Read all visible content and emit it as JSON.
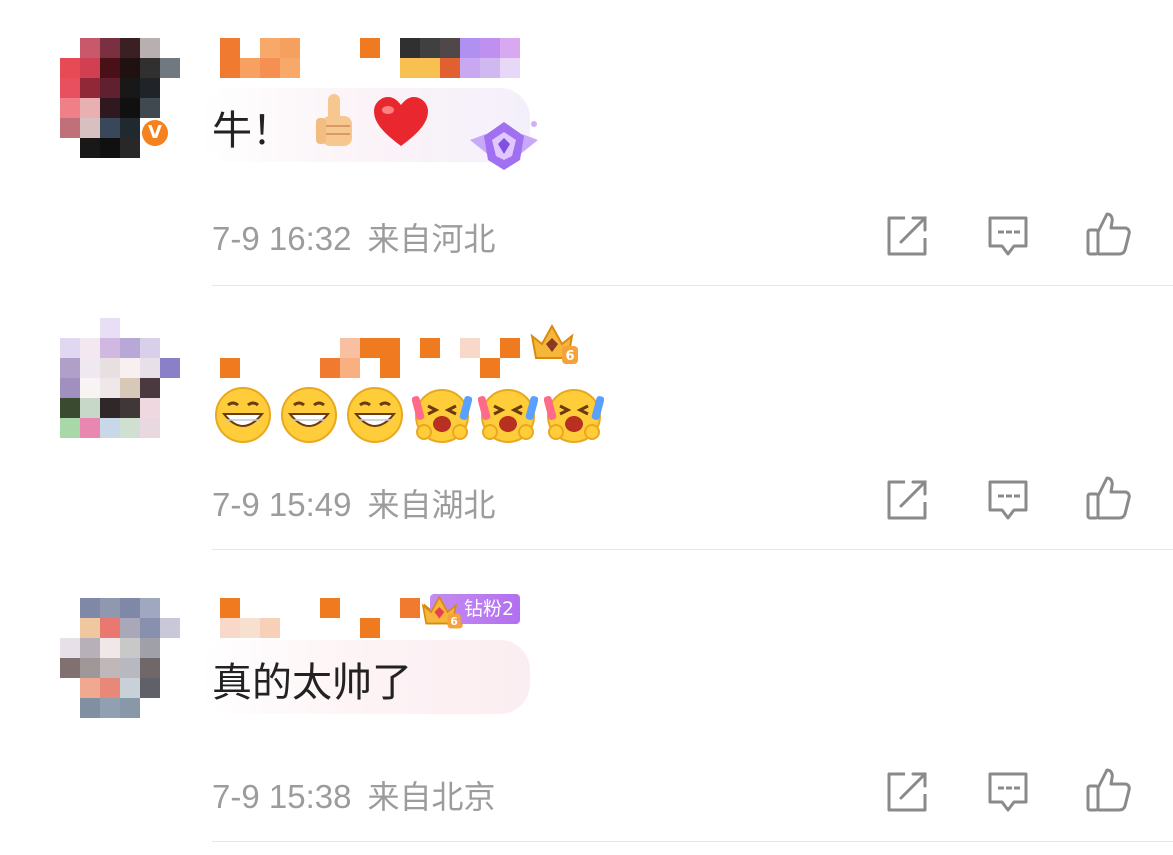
{
  "colors": {
    "meta_text": "#9c9c9c",
    "divider": "#e6e6e6",
    "orange": "#f5821f",
    "fan_badge": "#b26ff0"
  },
  "comments": [
    {
      "text": "牛！",
      "time": "7-9 16:32",
      "location": "来自河北",
      "emojis": [
        "thumbs-up-emoji",
        "red-heart-emoji"
      ],
      "badges": [
        "verified-v-badge",
        "purple-diamond-wing-badge"
      ]
    },
    {
      "text": "",
      "time": "7-9 15:49",
      "location": "来自湖北",
      "emojis": [
        "grinning-face-emoji",
        "grinning-face-emoji",
        "grinning-face-emoji",
        "laughing-cheer-emoji",
        "laughing-cheer-emoji",
        "laughing-cheer-emoji"
      ],
      "badges": [
        "crown-level-6-badge"
      ]
    },
    {
      "text": "真的太帅了",
      "time": "7-9 15:38",
      "location": "来自北京",
      "emojis": [],
      "badges": [
        "crown-level-6-badge"
      ],
      "fan_badge": "钻粉2"
    }
  ],
  "actions": {
    "share_icon": "share-icon",
    "reply_icon": "reply-icon",
    "like_icon": "like-icon"
  }
}
